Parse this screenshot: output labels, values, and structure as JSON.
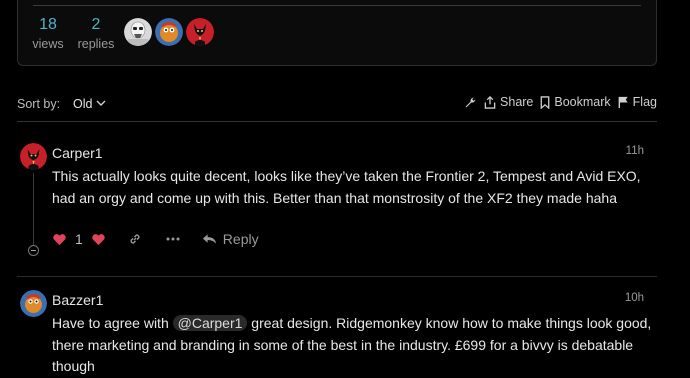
{
  "topic_summary": {
    "views_count": "18",
    "views_label": "views",
    "replies_count": "2",
    "replies_label": "replies",
    "participants": [
      "stormtrooper-avatar",
      "cartoon-avatar",
      "devil-avatar"
    ]
  },
  "controls": {
    "sort_label": "Sort by:",
    "sort_value": "Old",
    "share_label": "Share",
    "bookmark_label": "Bookmark",
    "flag_label": "Flag"
  },
  "posts": [
    {
      "username": "Carper1",
      "time": "11h",
      "body": "This actually looks quite decent, looks like they’ve taken the Frontier 2, Tempest and Avid EXO, had an orgy and come up with this. Better than that monstrosity of the XF2 they made haha",
      "like_count": "1",
      "reply_label": "Reply"
    },
    {
      "username": "Bazzer1",
      "time": "10h",
      "body_before": "Have to agree with ",
      "mention": "@Carper1",
      "body_after": " great design. Ridgemonkey know how to make things look good, there marketing and branding in some of the best in the industry. £699 for a bivvy is debatable though"
    }
  ],
  "colors": {
    "background": "#000000",
    "accent_blue": "#4fb3c9",
    "like_red": "#e0435a",
    "avatar_red": "#c8202a"
  }
}
